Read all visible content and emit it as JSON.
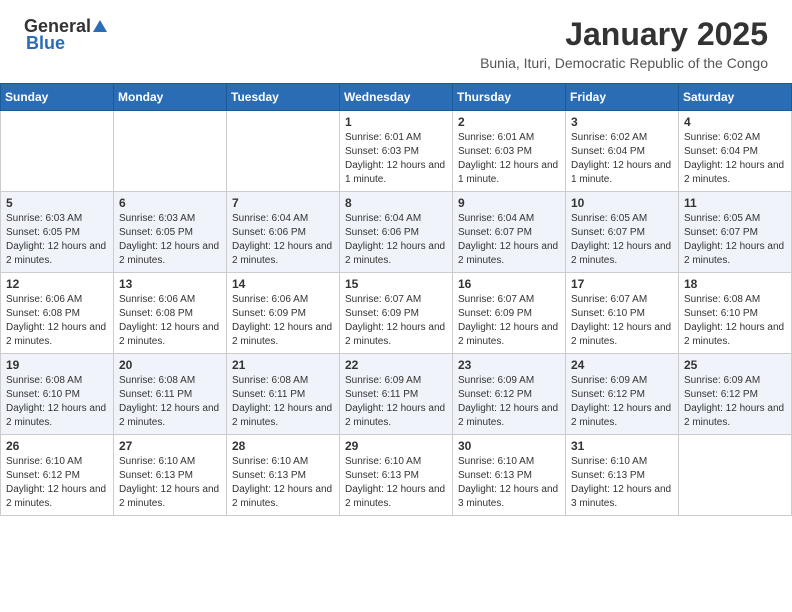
{
  "header": {
    "logo_general": "General",
    "logo_blue": "Blue",
    "month": "January 2025",
    "location": "Bunia, Ituri, Democratic Republic of the Congo"
  },
  "weekdays": [
    "Sunday",
    "Monday",
    "Tuesday",
    "Wednesday",
    "Thursday",
    "Friday",
    "Saturday"
  ],
  "weeks": [
    [
      {
        "day": "",
        "info": ""
      },
      {
        "day": "",
        "info": ""
      },
      {
        "day": "",
        "info": ""
      },
      {
        "day": "1",
        "info": "Sunrise: 6:01 AM\nSunset: 6:03 PM\nDaylight: 12 hours and 1 minute."
      },
      {
        "day": "2",
        "info": "Sunrise: 6:01 AM\nSunset: 6:03 PM\nDaylight: 12 hours and 1 minute."
      },
      {
        "day": "3",
        "info": "Sunrise: 6:02 AM\nSunset: 6:04 PM\nDaylight: 12 hours and 1 minute."
      },
      {
        "day": "4",
        "info": "Sunrise: 6:02 AM\nSunset: 6:04 PM\nDaylight: 12 hours and 2 minutes."
      }
    ],
    [
      {
        "day": "5",
        "info": "Sunrise: 6:03 AM\nSunset: 6:05 PM\nDaylight: 12 hours and 2 minutes."
      },
      {
        "day": "6",
        "info": "Sunrise: 6:03 AM\nSunset: 6:05 PM\nDaylight: 12 hours and 2 minutes."
      },
      {
        "day": "7",
        "info": "Sunrise: 6:04 AM\nSunset: 6:06 PM\nDaylight: 12 hours and 2 minutes."
      },
      {
        "day": "8",
        "info": "Sunrise: 6:04 AM\nSunset: 6:06 PM\nDaylight: 12 hours and 2 minutes."
      },
      {
        "day": "9",
        "info": "Sunrise: 6:04 AM\nSunset: 6:07 PM\nDaylight: 12 hours and 2 minutes."
      },
      {
        "day": "10",
        "info": "Sunrise: 6:05 AM\nSunset: 6:07 PM\nDaylight: 12 hours and 2 minutes."
      },
      {
        "day": "11",
        "info": "Sunrise: 6:05 AM\nSunset: 6:07 PM\nDaylight: 12 hours and 2 minutes."
      }
    ],
    [
      {
        "day": "12",
        "info": "Sunrise: 6:06 AM\nSunset: 6:08 PM\nDaylight: 12 hours and 2 minutes."
      },
      {
        "day": "13",
        "info": "Sunrise: 6:06 AM\nSunset: 6:08 PM\nDaylight: 12 hours and 2 minutes."
      },
      {
        "day": "14",
        "info": "Sunrise: 6:06 AM\nSunset: 6:09 PM\nDaylight: 12 hours and 2 minutes."
      },
      {
        "day": "15",
        "info": "Sunrise: 6:07 AM\nSunset: 6:09 PM\nDaylight: 12 hours and 2 minutes."
      },
      {
        "day": "16",
        "info": "Sunrise: 6:07 AM\nSunset: 6:09 PM\nDaylight: 12 hours and 2 minutes."
      },
      {
        "day": "17",
        "info": "Sunrise: 6:07 AM\nSunset: 6:10 PM\nDaylight: 12 hours and 2 minutes."
      },
      {
        "day": "18",
        "info": "Sunrise: 6:08 AM\nSunset: 6:10 PM\nDaylight: 12 hours and 2 minutes."
      }
    ],
    [
      {
        "day": "19",
        "info": "Sunrise: 6:08 AM\nSunset: 6:10 PM\nDaylight: 12 hours and 2 minutes."
      },
      {
        "day": "20",
        "info": "Sunrise: 6:08 AM\nSunset: 6:11 PM\nDaylight: 12 hours and 2 minutes."
      },
      {
        "day": "21",
        "info": "Sunrise: 6:08 AM\nSunset: 6:11 PM\nDaylight: 12 hours and 2 minutes."
      },
      {
        "day": "22",
        "info": "Sunrise: 6:09 AM\nSunset: 6:11 PM\nDaylight: 12 hours and 2 minutes."
      },
      {
        "day": "23",
        "info": "Sunrise: 6:09 AM\nSunset: 6:12 PM\nDaylight: 12 hours and 2 minutes."
      },
      {
        "day": "24",
        "info": "Sunrise: 6:09 AM\nSunset: 6:12 PM\nDaylight: 12 hours and 2 minutes."
      },
      {
        "day": "25",
        "info": "Sunrise: 6:09 AM\nSunset: 6:12 PM\nDaylight: 12 hours and 2 minutes."
      }
    ],
    [
      {
        "day": "26",
        "info": "Sunrise: 6:10 AM\nSunset: 6:12 PM\nDaylight: 12 hours and 2 minutes."
      },
      {
        "day": "27",
        "info": "Sunrise: 6:10 AM\nSunset: 6:13 PM\nDaylight: 12 hours and 2 minutes."
      },
      {
        "day": "28",
        "info": "Sunrise: 6:10 AM\nSunset: 6:13 PM\nDaylight: 12 hours and 2 minutes."
      },
      {
        "day": "29",
        "info": "Sunrise: 6:10 AM\nSunset: 6:13 PM\nDaylight: 12 hours and 2 minutes."
      },
      {
        "day": "30",
        "info": "Sunrise: 6:10 AM\nSunset: 6:13 PM\nDaylight: 12 hours and 3 minutes."
      },
      {
        "day": "31",
        "info": "Sunrise: 6:10 AM\nSunset: 6:13 PM\nDaylight: 12 hours and 3 minutes."
      },
      {
        "day": "",
        "info": ""
      }
    ]
  ]
}
